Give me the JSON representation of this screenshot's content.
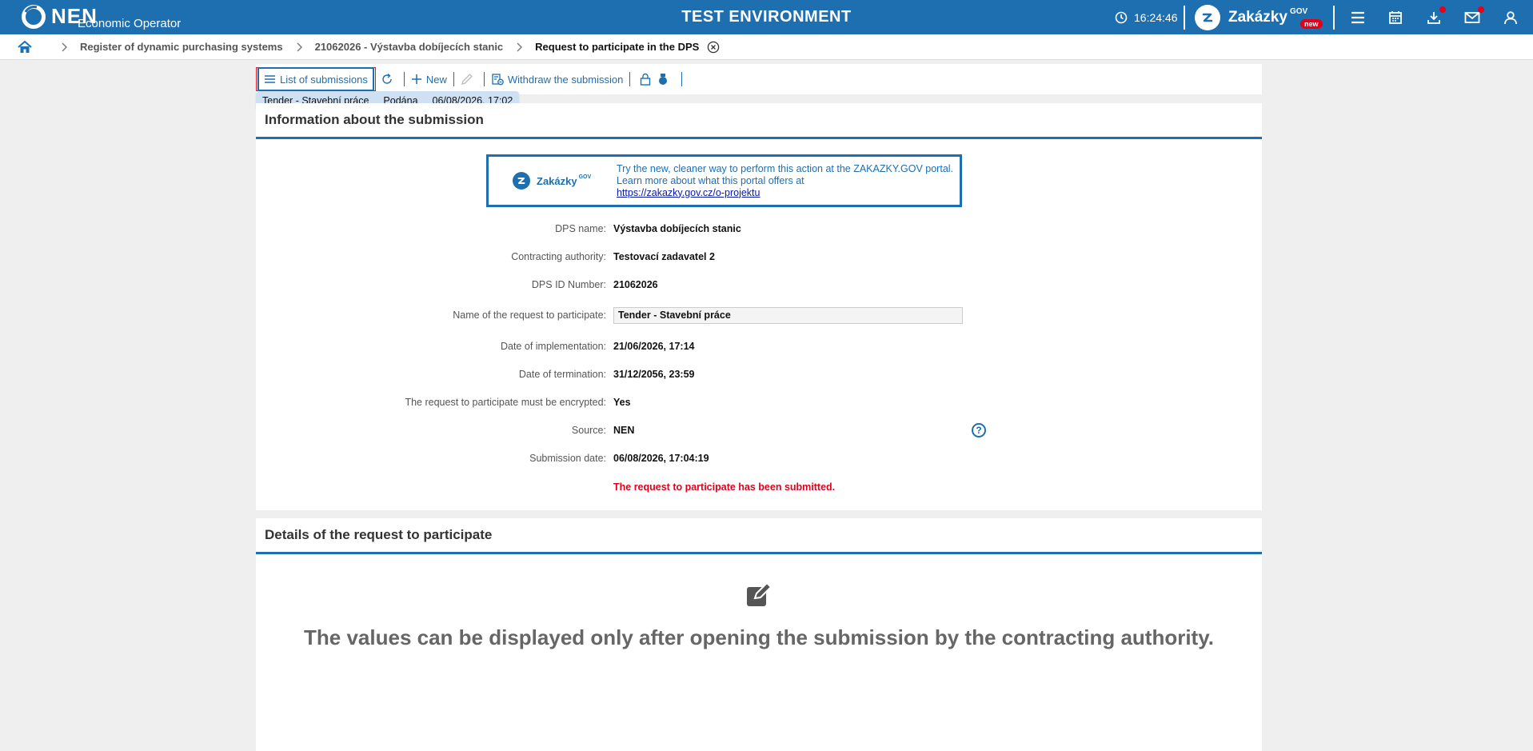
{
  "header": {
    "logo_text": "NEN",
    "logo_subtitle": "Economic Operator",
    "environment": "TEST ENVIRONMENT",
    "time": "16:24:46",
    "zakazky_name": "Zakázky",
    "zakazky_gov": "GOV",
    "zakazky_badge": "new",
    "icons": [
      "menu-icon",
      "calendar-icon",
      "download-icon",
      "mail-icon",
      "user-icon"
    ],
    "accent_color": "#1e6fb0",
    "notification_color": "#e3001b"
  },
  "breadcrumb": {
    "items": [
      "Register of dynamic purchasing systems",
      "21062026 - Výstavba dobíjecích stanic",
      "Request to participate in the DPS"
    ]
  },
  "toolbar": {
    "list_label": "List of submissions",
    "new_label": "New",
    "withdraw_label": "Withdraw the submission"
  },
  "dropdown": {
    "name": "Tender - Stavební práce",
    "status": "Podána",
    "date": "06/08/2026, 17:02"
  },
  "info_panel": {
    "title": "Information about the submission",
    "banner": {
      "logo_name": "Zakázky",
      "logo_gov": "GOV",
      "line1": "Try the new, cleaner way to perform this action at the ZAKAZKY.GOV portal.",
      "line2": "Learn more about what this portal offers at",
      "link": "https://zakazky.gov.cz/o-projektu"
    },
    "fields": {
      "dps_name": {
        "label": "DPS name:",
        "value": "Výstavba dobíjecích stanic"
      },
      "authority": {
        "label": "Contracting authority:",
        "value": "Testovací zadavatel 2"
      },
      "dps_id": {
        "label": "DPS ID Number:",
        "value": "21062026"
      },
      "request_name": {
        "label": "Name of the request to participate:",
        "value": "Tender - Stavební práce"
      },
      "impl_date": {
        "label": "Date of implementation:",
        "value": "21/06/2026, 17:14"
      },
      "term_date": {
        "label": "Date of termination:",
        "value": "31/12/2056, 23:59"
      },
      "encrypted": {
        "label": "The request to participate must be encrypted:",
        "value": "Yes"
      },
      "source": {
        "label": "Source:",
        "value": "NEN"
      },
      "submission_date": {
        "label": "Submission date:",
        "value": "06/08/2026, 17:04:19"
      }
    },
    "help_symbol": "?",
    "status_message": "The request to participate has been submitted."
  },
  "details_panel": {
    "title": "Details of the request to participate",
    "message": "The values can be displayed only after opening the submission by the contracting authority."
  }
}
